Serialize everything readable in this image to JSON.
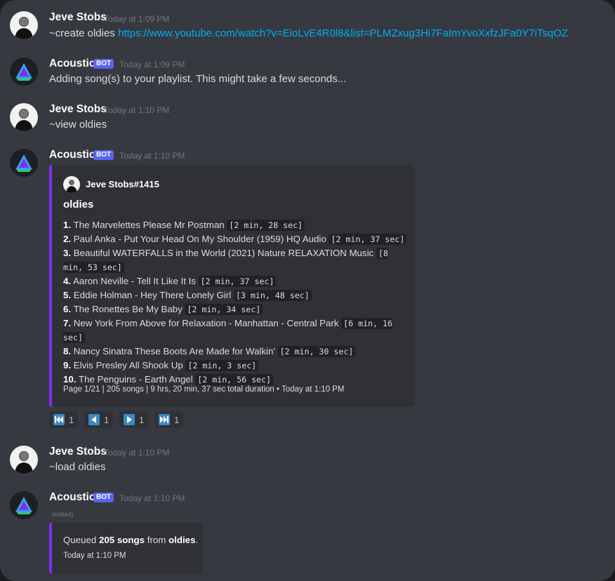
{
  "user_name": "Jeve Stobs",
  "bot_name": "Acoustic",
  "bot_tag": "BOT",
  "messages": [
    {
      "author": "Jeve Stobs",
      "time": "Today at 1:09 PM",
      "text": "~create oldies ",
      "link": "https://www.youtube.com/watch?v=EioLvE4R0l8&list=PLMZxug3Hi7FaImYvoXxfzJFa0Y7iTsqOZ"
    },
    {
      "author": "Acoustic",
      "time": "Today at 1:09 PM",
      "text": "Adding song(s) to your playlist. This might take a few seconds..."
    },
    {
      "author": "Jeve Stobs",
      "time": "Today at 1:10 PM",
      "text": "~view oldies"
    },
    {
      "author": "Acoustic",
      "time": "Today at 1:10 PM"
    },
    {
      "author": "Jeve Stobs",
      "time": "Today at 1:10 PM",
      "text": "~load oldies"
    },
    {
      "author": "Acoustic",
      "time": "Today at 1:10 PM",
      "edited": "(edited)"
    }
  ],
  "playlist_embed": {
    "author": "Jeve Stobs#1415",
    "title": "oldies",
    "songs": [
      {
        "num": "1.",
        "title": "The Marvelettes Please Mr Postman",
        "duration": "[2 min, 28 sec]"
      },
      {
        "num": "2.",
        "title": "Paul Anka - Put Your Head On My Shoulder (1959) HQ Audio",
        "duration": "[2 min, 37 sec]"
      },
      {
        "num": "3.",
        "title": "Beautiful WATERFALLS in the World (2021) Nature RELAXATION Music",
        "duration": "[8 min, 53 sec]"
      },
      {
        "num": "4.",
        "title": "Aaron Neville - Tell It Like It Is",
        "duration": "[2 min, 37 sec]"
      },
      {
        "num": "5.",
        "title": "Eddie Holman - Hey There Lonely Girl",
        "duration": "[3 min, 48 sec]"
      },
      {
        "num": "6.",
        "title": "The Ronettes Be My Baby",
        "duration": "[2 min, 34 sec]"
      },
      {
        "num": "7.",
        "title": "New York From Above for Relaxation - Manhattan - Central Park",
        "duration": "[6 min, 16 sec]"
      },
      {
        "num": "8.",
        "title": "Nancy Sinatra These Boots Are Made for Walkin'",
        "duration": "[2 min, 30 sec]"
      },
      {
        "num": "9.",
        "title": "Elvis Presley All Shook Up",
        "duration": "[2 min, 3 sec]"
      },
      {
        "num": "10.",
        "title": "The Penguins - Earth Angel",
        "duration": "[2 min, 56 sec]"
      }
    ],
    "footer_info": "Page 1/21 | 205 songs | 9 hrs, 20 min, 37 sec total duration",
    "footer_sep": "•",
    "footer_time": "Today at 1:10 PM"
  },
  "reactions": [
    {
      "icon": "first-page-icon",
      "glyph": "⏮",
      "count": "1"
    },
    {
      "icon": "previous-page-icon",
      "glyph": "◀",
      "count": "1"
    },
    {
      "icon": "next-page-icon",
      "glyph": "▶",
      "count": "1"
    },
    {
      "icon": "last-page-icon",
      "glyph": "⏭",
      "count": "1"
    }
  ],
  "queue_embed": {
    "prefix": "Queued ",
    "count": "205 songs",
    "middle": " from ",
    "playlist": "oldies",
    "suffix": ".",
    "time": "Today at 1:10 PM"
  },
  "colors": {
    "background": "#36393f",
    "embed_bg": "#2f3136",
    "embed_accent": "#7b2ff2",
    "bot_tag": "#5865f2",
    "link": "#00aff4",
    "reaction_icon": "#3b88c3"
  }
}
